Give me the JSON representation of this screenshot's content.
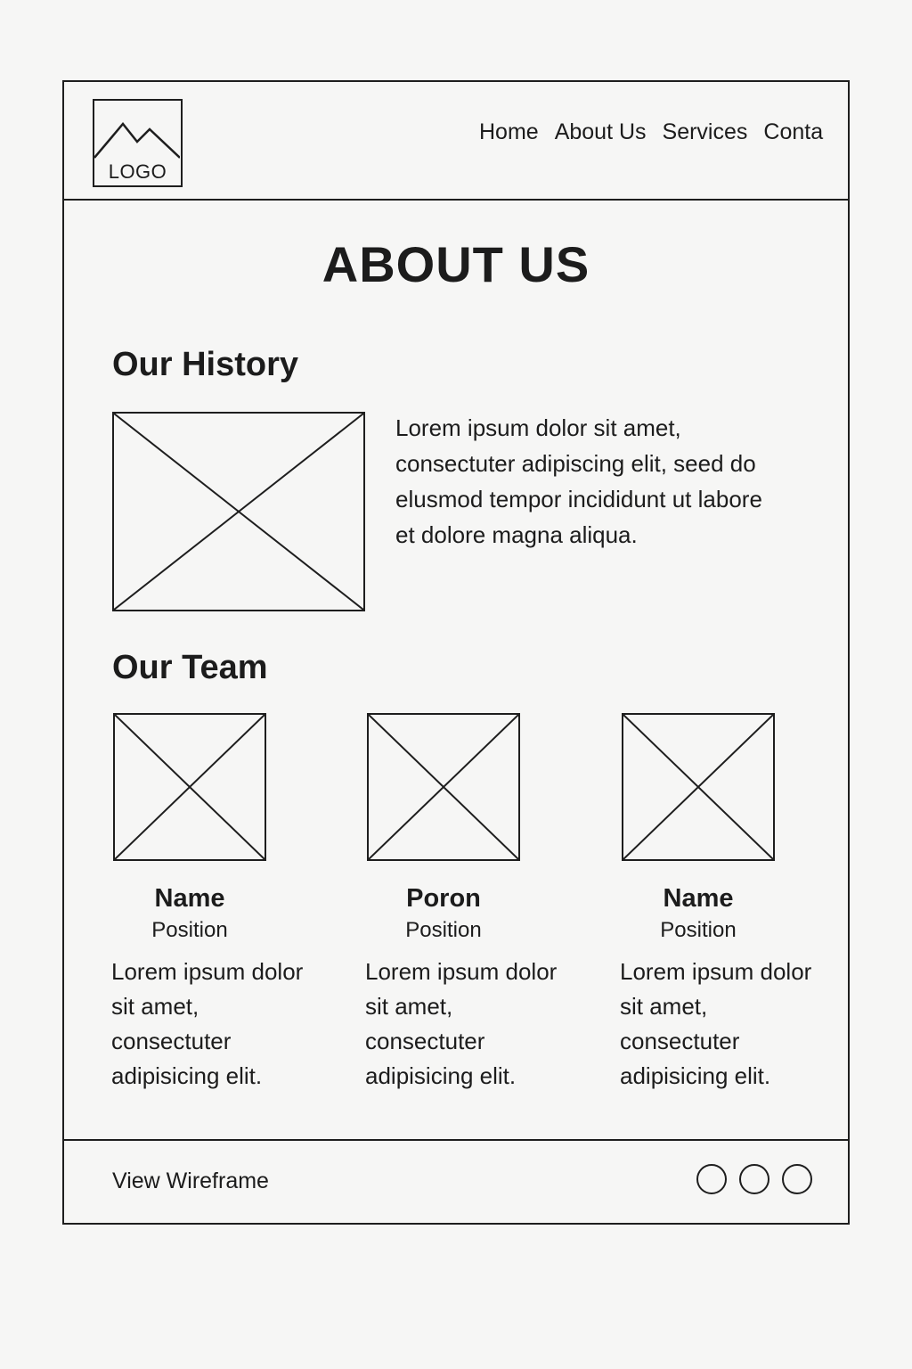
{
  "header": {
    "logo_text": "LOGO",
    "nav": [
      "Home",
      "About Us",
      "Services",
      "Conta"
    ]
  },
  "page_title": "ABOUT US",
  "history": {
    "title": "Our History",
    "text": "Lorem ipsum dolor sit amet, consectuter adipiscing elit, seed do elusmod tempor incididunt ut labore et dolore magna aliqua."
  },
  "team": {
    "title": "Our Team",
    "members": [
      {
        "name": "Name",
        "position": "Position",
        "desc": "Lorem ipsum dolor sit amet, consectuter adipisicing elit."
      },
      {
        "name": "Poron",
        "position": "Position",
        "desc": "Lorem ipsum dolor sit amet, consectuter adipisicing elit."
      },
      {
        "name": "Name",
        "position": "Position",
        "desc": "Lorem ipsum dolor sit amet, consectuter adipisicing elit."
      }
    ]
  },
  "footer": {
    "link": "View Wireframe",
    "dots": 3
  }
}
